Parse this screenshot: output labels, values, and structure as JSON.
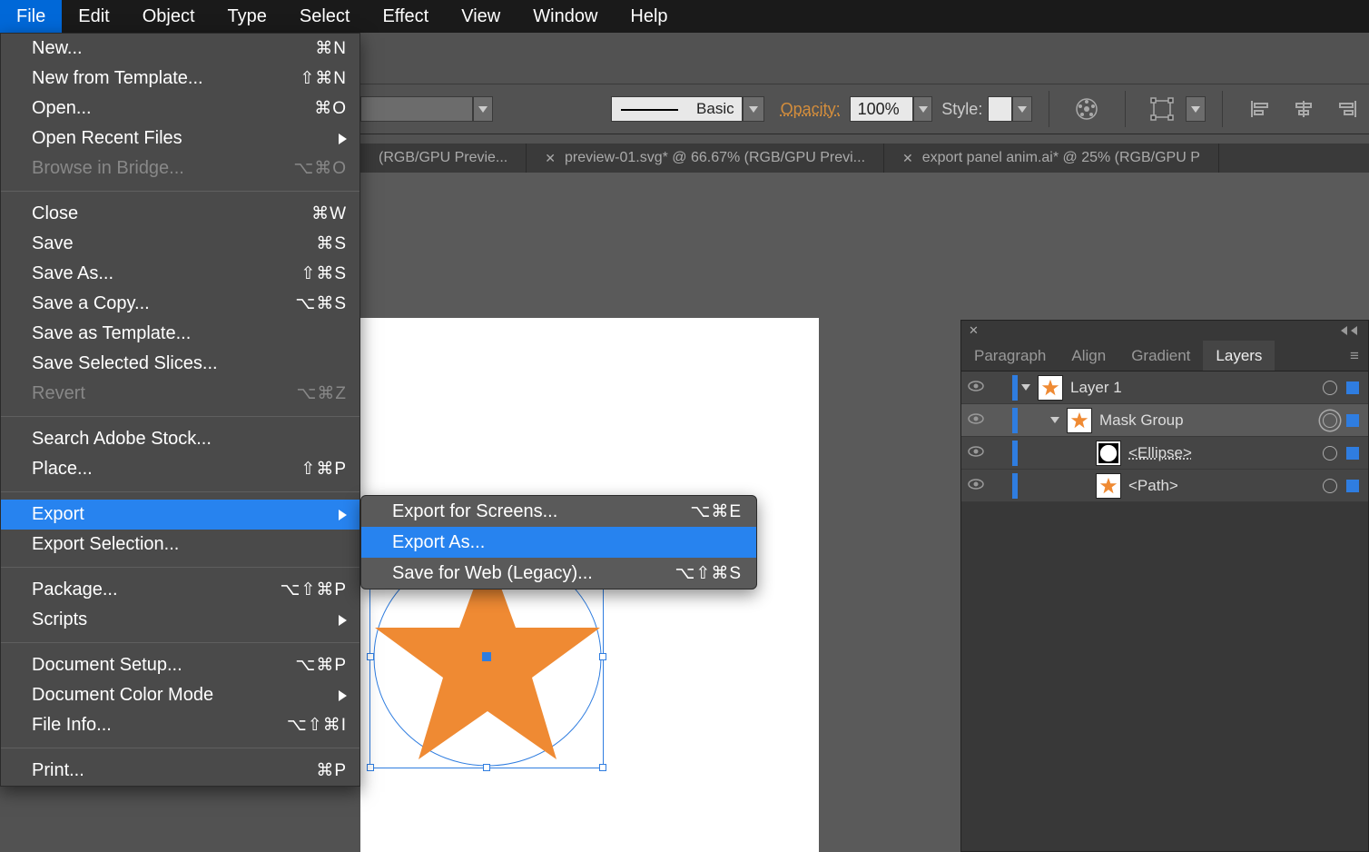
{
  "menubar": [
    "File",
    "Edit",
    "Object",
    "Type",
    "Select",
    "Effect",
    "View",
    "Window",
    "Help"
  ],
  "file_menu": {
    "groups": [
      [
        {
          "label": "New...",
          "shortcut": "⌘N"
        },
        {
          "label": "New from Template...",
          "shortcut": "⇧⌘N"
        },
        {
          "label": "Open...",
          "shortcut": "⌘O"
        },
        {
          "label": "Open Recent Files",
          "submenu": true
        },
        {
          "label": "Browse in Bridge...",
          "shortcut": "⌥⌘O",
          "disabled": true
        }
      ],
      [
        {
          "label": "Close",
          "shortcut": "⌘W"
        },
        {
          "label": "Save",
          "shortcut": "⌘S"
        },
        {
          "label": "Save As...",
          "shortcut": "⇧⌘S"
        },
        {
          "label": "Save a Copy...",
          "shortcut": "⌥⌘S"
        },
        {
          "label": "Save as Template..."
        },
        {
          "label": "Save Selected Slices..."
        },
        {
          "label": "Revert",
          "shortcut": "⌥⌘Z",
          "disabled": true
        }
      ],
      [
        {
          "label": "Search Adobe Stock..."
        },
        {
          "label": "Place...",
          "shortcut": "⇧⌘P"
        }
      ],
      [
        {
          "label": "Export",
          "submenu": true,
          "highlight": true
        },
        {
          "label": "Export Selection..."
        }
      ],
      [
        {
          "label": "Package...",
          "shortcut": "⌥⇧⌘P"
        },
        {
          "label": "Scripts",
          "submenu": true
        }
      ],
      [
        {
          "label": "Document Setup...",
          "shortcut": "⌥⌘P"
        },
        {
          "label": "Document Color Mode",
          "submenu": true
        },
        {
          "label": "File Info...",
          "shortcut": "⌥⇧⌘I"
        }
      ],
      [
        {
          "label": "Print...",
          "shortcut": "⌘P"
        }
      ]
    ]
  },
  "export_menu": [
    {
      "label": "Export for Screens...",
      "shortcut": "⌥⌘E"
    },
    {
      "label": "Export As...",
      "highlight": true
    },
    {
      "label": "Save for Web (Legacy)...",
      "shortcut": "⌥⇧⌘S"
    }
  ],
  "control_bar": {
    "stroke_preset": "Basic",
    "opacity_label": "Opacity:",
    "opacity_value": "100%",
    "style_label": "Style:"
  },
  "doc_tabs": [
    {
      "title": "(RGB/GPU Previe...",
      "close": false
    },
    {
      "title": "preview-01.svg* @ 66.67% (RGB/GPU Previ...",
      "close": true
    },
    {
      "title": "export panel anim.ai* @ 25% (RGB/GPU P",
      "close": true
    }
  ],
  "layers_panel": {
    "tabs": [
      "Paragraph",
      "Align",
      "Gradient",
      "Layers"
    ],
    "active_tab": "Layers",
    "rows": [
      {
        "indent": 0,
        "name": "Layer 1",
        "thumb": "star",
        "disclose": true
      },
      {
        "indent": 1,
        "name": "Mask Group",
        "thumb": "star",
        "disclose": true,
        "selected": true,
        "target_double": true
      },
      {
        "indent": 2,
        "name": "<Ellipse>",
        "thumb": "ellipse",
        "underline": true
      },
      {
        "indent": 2,
        "name": "<Path>",
        "thumb": "star"
      }
    ]
  }
}
